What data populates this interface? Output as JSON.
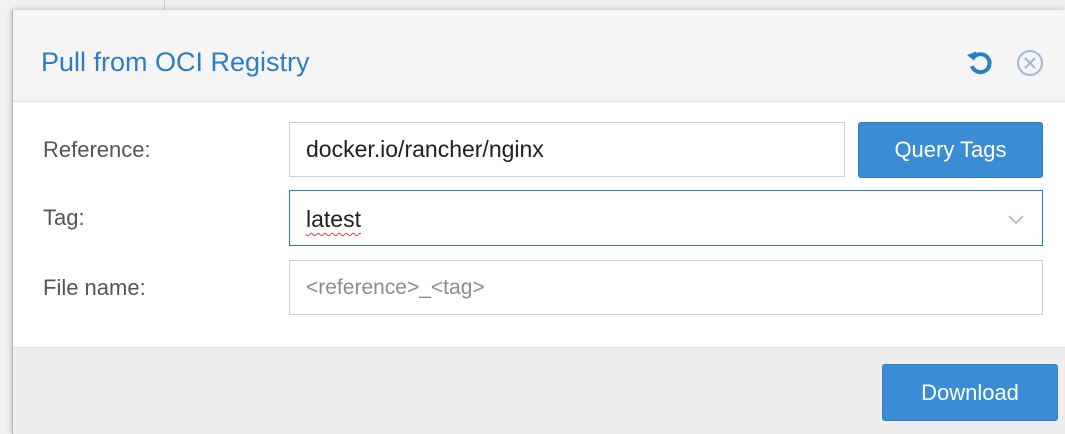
{
  "dialog": {
    "title": "Pull from OCI Registry",
    "tools": [
      {
        "icon": "reset-icon"
      },
      {
        "icon": "close-icon"
      }
    ]
  },
  "form": {
    "reference": {
      "label": "Reference:",
      "value": "docker.io/rancher/nginx"
    },
    "query_tags_label": "Query Tags",
    "tag": {
      "label": "Tag:",
      "value": "latest"
    },
    "file_name": {
      "label": "File name:",
      "value": "",
      "placeholder": "<reference>_<tag>"
    }
  },
  "footer": {
    "download_label": "Download"
  },
  "colors": {
    "accent": "#2a7fc4",
    "button": "#3a8dd4",
    "header_bg": "#f5f5f5",
    "footer_bg": "#eeeeee"
  }
}
